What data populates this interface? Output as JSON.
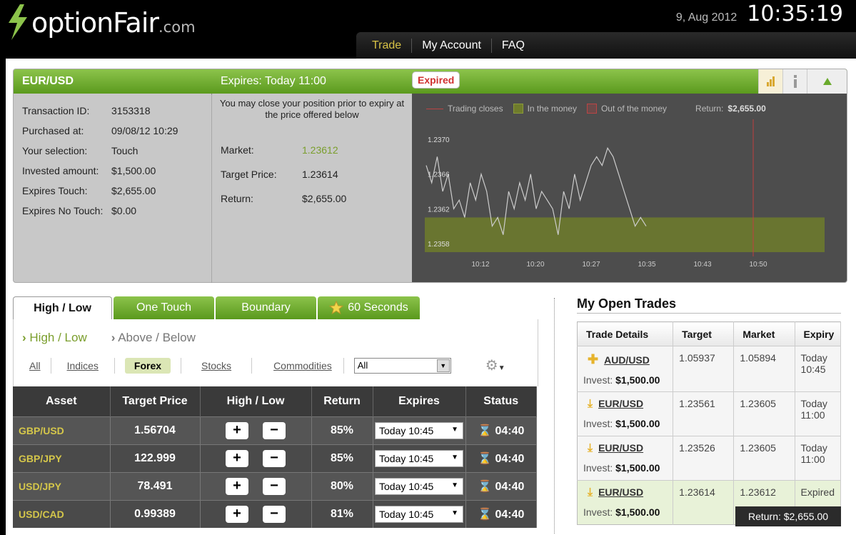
{
  "header": {
    "logo_main": "optionFair",
    "logo_suffix": ".com",
    "date": "9, Aug 2012",
    "time": "10:35:19"
  },
  "nav": {
    "items": [
      "Trade",
      "My Account",
      "FAQ"
    ]
  },
  "trade": {
    "pair": "EUR/USD",
    "expires": "Expires:  Today 11:00",
    "status": "Expired",
    "details": [
      {
        "label": "Transaction ID:",
        "value": "3153318"
      },
      {
        "label": "Purchased at:",
        "value": "09/08/12 10:29"
      },
      {
        "label": "Your selection:",
        "value": "Touch"
      },
      {
        "label": "Invested amount:",
        "value": "$1,500.00"
      },
      {
        "label": "Expires Touch:",
        "value": "$2,655.00"
      },
      {
        "label": "Expires No Touch:",
        "value": "$0.00"
      }
    ],
    "note": "You may close your position prior to expiry at the price offered below",
    "market_label": "Market:",
    "market": "1.23612",
    "target_label": "Target Price:",
    "target": "1.23614",
    "return_label": "Return:",
    "return": "$2,655.00"
  },
  "chart_legend": {
    "trading": "Trading closes",
    "in": "In the money",
    "out": "Out of the money",
    "return_prefix": "Return:",
    "return_value": "$2,655.00"
  },
  "chart_data": {
    "type": "line",
    "yticks": [
      "1.2370",
      "1.2366",
      "1.2362",
      "1.2358"
    ],
    "xticks": [
      "10:12",
      "10:20",
      "10:27",
      "10:35",
      "10:43",
      "10:50"
    ],
    "ylim": [
      1.2357,
      1.2371
    ],
    "values": [
      1.2367,
      1.2365,
      1.2368,
      1.2364,
      1.2366,
      1.2362,
      1.2363,
      1.2361,
      1.2365,
      1.2363,
      1.2366,
      1.2364,
      1.236,
      1.2361,
      1.2359,
      1.2364,
      1.2362,
      1.2365,
      1.2363,
      1.2366,
      1.2362,
      1.2364,
      1.2363,
      1.2362,
      1.2359,
      1.2364,
      1.2362,
      1.2366,
      1.2363,
      1.2365,
      1.2367,
      1.2368,
      1.2367,
      1.2369,
      1.2368,
      1.2366,
      1.2364,
      1.2362,
      1.236,
      1.2361,
      1.236
    ],
    "colors": {
      "line": "#cccccc",
      "in_money": "#6f7c2c",
      "marker": "#c04040"
    }
  },
  "tabs": [
    "High / Low",
    "One Touch",
    "Boundary",
    "60 Seconds"
  ],
  "subtabs": [
    "High / Low",
    "Above / Below"
  ],
  "filters": [
    "All",
    "Indices",
    "Forex",
    "Stocks",
    "Commodities"
  ],
  "filter_select": "All",
  "table": {
    "headers": [
      "Asset",
      "Target Price",
      "High / Low",
      "Return",
      "Expires",
      "Status"
    ],
    "rows": [
      {
        "asset": "GBP/USD",
        "price": "1.56704",
        "ret": "85%",
        "exp": "Today 10:45",
        "status": "04:40"
      },
      {
        "asset": "GBP/JPY",
        "price": "122.999",
        "ret": "85%",
        "exp": "Today 10:45",
        "status": "04:40"
      },
      {
        "asset": "USD/JPY",
        "price": "78.491",
        "ret": "80%",
        "exp": "Today 10:45",
        "status": "04:40"
      },
      {
        "asset": "USD/CAD",
        "price": "0.99389",
        "ret": "81%",
        "exp": "Today 10:45",
        "status": "04:40"
      }
    ]
  },
  "open_trades": {
    "title": "My Open Trades",
    "headers": [
      "Trade Details",
      "Target",
      "Market",
      "Expiry"
    ],
    "invest_label": "Invest:",
    "rows": [
      {
        "pair": "AUD/USD",
        "invest": "$1,500.00",
        "target": "1.05937",
        "market": "1.05894",
        "expiry": "Today 10:45"
      },
      {
        "pair": "EUR/USD",
        "invest": "$1,500.00",
        "target": "1.23561",
        "market": "1.23605",
        "expiry": "Today 11:00"
      },
      {
        "pair": "EUR/USD",
        "invest": "$1,500.00",
        "target": "1.23526",
        "market": "1.23605",
        "expiry": "Today 11:00"
      },
      {
        "pair": "EUR/USD",
        "invest": "$1,500.00",
        "target": "1.23614",
        "market": "1.23612",
        "expiry": "Expired",
        "return": "Return: $2,655.00"
      }
    ]
  }
}
